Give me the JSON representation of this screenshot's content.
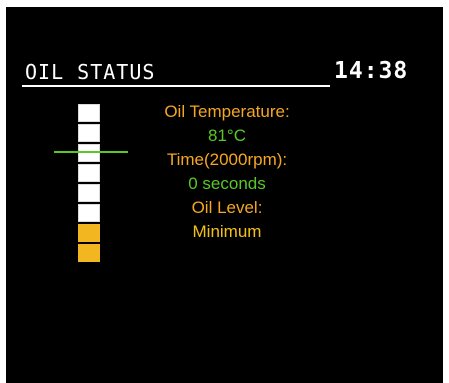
{
  "header": {
    "title": "OIL STATUS",
    "clock": "14:38"
  },
  "gauge": {
    "segments_total": 8,
    "segments_filled": 2,
    "marker_segment": 3,
    "filled_color": "#f2b620",
    "marker_color": "#5ac728"
  },
  "info": {
    "temp_label": "Oil Temperature:",
    "temp_value": "81°C",
    "time_label": "Time(2000rpm):",
    "time_value": "0 seconds",
    "level_label": "Oil Level:",
    "level_value": "Minimum"
  },
  "colors": {
    "label": "#f5a623",
    "value_ok": "#5ac728",
    "value_warn": "#f5c016"
  }
}
